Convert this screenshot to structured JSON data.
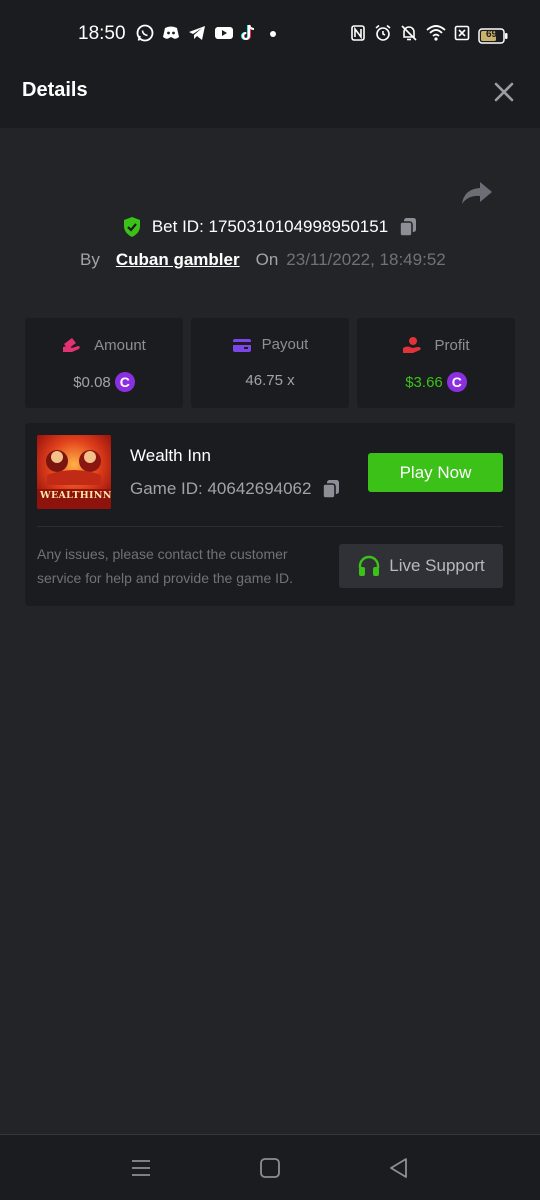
{
  "status_bar": {
    "time": "18:50",
    "battery": "69",
    "app_icons": [
      "whatsapp-icon",
      "discord-icon",
      "telegram-icon",
      "youtube-icon",
      "tiktok-icon",
      "dot-icon"
    ],
    "system_icons": [
      "nfc-icon",
      "alarm-icon",
      "bell-off-icon",
      "wifi-icon",
      "sim-off-icon",
      "battery-icon"
    ]
  },
  "header": {
    "title": "Details"
  },
  "bet": {
    "id_text": "Bet ID: 1750310104998950151",
    "by_label": "By",
    "username": "Cuban gambler",
    "on_label": "On",
    "date": "23/11/2022, 18:49:52"
  },
  "stats": {
    "amount": {
      "label": "Amount",
      "value": "$0.08"
    },
    "payout": {
      "label": "Payout",
      "value": "46.75 x"
    },
    "profit": {
      "label": "Profit",
      "value": "$3.66"
    },
    "coin_symbol": "C"
  },
  "game": {
    "name": "Wealth Inn",
    "id_text": "Game ID: 40642694062",
    "thumb_text": "WEALTHINN",
    "play_label": "Play Now",
    "issue_text": "Any issues, please contact the customer service for help and provide the game ID.",
    "support_label": "Live Support"
  },
  "colors": {
    "background": "#232428",
    "panel": "#1b1c1f",
    "accent_green": "#3bc117",
    "coin_purple": "#8b2fe0",
    "amount_pink": "#e0336f",
    "payout_purple": "#7b45e8",
    "profit_red": "#e0333a"
  }
}
